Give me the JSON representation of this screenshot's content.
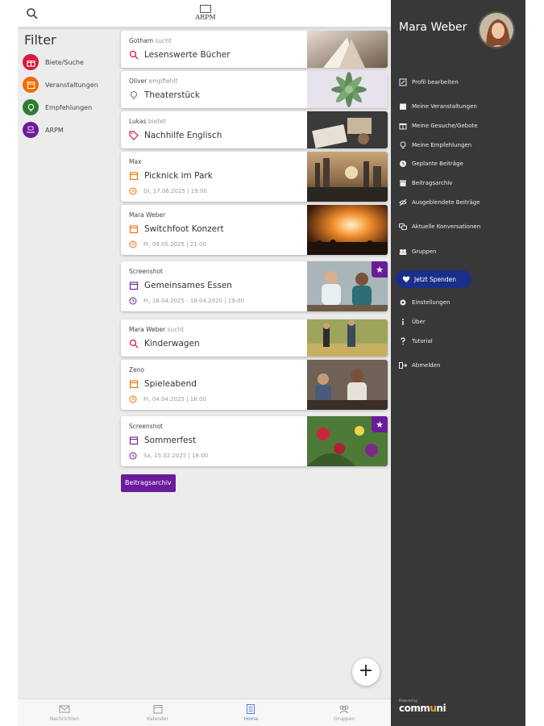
{
  "topbar": {
    "logo_text": "ARPM",
    "search_icon": "search-icon"
  },
  "filter": {
    "title": "Filter",
    "items": [
      {
        "label": "Biete/Suche",
        "color": "#d81b3c",
        "icon": "gift-icon"
      },
      {
        "label": "Veranstaltungen",
        "color": "#ef6c00",
        "icon": "calendar-icon"
      },
      {
        "label": "Empfehlungen",
        "color": "#2e7d32",
        "icon": "lightbulb-icon"
      },
      {
        "label": "ARPM",
        "color": "#6a1b9a",
        "icon": "arpm-logo-icon"
      }
    ]
  },
  "feed": {
    "cards": [
      {
        "author": "Gotham",
        "verb": "sucht",
        "title": "Lesenswerte Bücher",
        "icon": "search-icon",
        "icon_color": "#d81b3c",
        "date": "",
        "starred": false,
        "thumb": "book-photo"
      },
      {
        "author": "Oliver",
        "verb": "empfiehlt",
        "title": "Theaterstück",
        "icon": "lightbulb-icon",
        "icon_color": "#2e7d32",
        "date": "",
        "starred": false,
        "thumb": "succulent-photo"
      },
      {
        "author": "Lukas",
        "verb": "bietet",
        "title": "Nachhilfe Englisch",
        "icon": "tag-icon",
        "icon_color": "#d81b3c",
        "date": "",
        "starred": false,
        "thumb": "study-photo"
      },
      {
        "author": "Max",
        "verb": "",
        "title": "Picknick im Park",
        "icon": "calendar-icon",
        "icon_color": "#ef6c00",
        "date": "Di, 17.06.2025 | 19:00",
        "date_icon_color": "#ef6c00",
        "starred": false,
        "thumb": "city-sunset-photo"
      },
      {
        "author": "Mara Weber",
        "verb": "",
        "title": "Switchfoot Konzert",
        "icon": "calendar-icon",
        "icon_color": "#ef6c00",
        "date": "Fr, 09.05.2025 | 21:00",
        "date_icon_color": "#ef6c00",
        "starred": false,
        "thumb": "concert-photo"
      },
      {
        "author": "Screenshot",
        "verb": "",
        "title": "Gemeinsames Essen",
        "icon": "calendar-icon",
        "icon_color": "#6a1b9a",
        "date": "Fr, 18.04.2025 - 18.04.2020 | 19:00",
        "date_icon_color": "#6a1b9a",
        "starred": true,
        "thumb": "friends-photo"
      },
      {
        "author": "Mara Weber",
        "verb": "sucht",
        "title": "Kinderwagen",
        "icon": "search-icon",
        "icon_color": "#d81b3c",
        "date": "",
        "starred": false,
        "thumb": "park-family-photo"
      },
      {
        "author": "Zeno",
        "verb": "",
        "title": "Spieleabend",
        "icon": "calendar-icon",
        "icon_color": "#ef6c00",
        "date": "Fr, 04.04.2025 | 18:00",
        "date_icon_color": "#ef6c00",
        "starred": false,
        "thumb": "game-night-photo"
      },
      {
        "author": "Screenshot",
        "verb": "",
        "title": "Sommerfest",
        "icon": "calendar-icon",
        "icon_color": "#6a1b9a",
        "date": "Sa, 15.02.2025 | 18:00",
        "date_icon_color": "#6a1b9a",
        "starred": true,
        "thumb": "flowers-photo"
      }
    ],
    "archive_button": "Beitragsarchiv"
  },
  "fab": {
    "label": "+"
  },
  "bottomnav": {
    "items": [
      {
        "label": "Nachrichten",
        "icon": "mail-icon",
        "active": false
      },
      {
        "label": "Kalender",
        "icon": "calendar-icon",
        "active": false
      },
      {
        "label": "Home",
        "icon": "list-icon",
        "active": true
      },
      {
        "label": "Gruppen",
        "icon": "group-icon",
        "active": false
      }
    ]
  },
  "drawer": {
    "user_name": "Mara Weber",
    "menu": [
      {
        "label": "Profil bearbeiten",
        "icon": "edit-icon"
      },
      {
        "label": "Meine Veranstaltungen",
        "icon": "calendar-icon"
      },
      {
        "label": "Meine Gesuche/Gebote",
        "icon": "gift-icon"
      },
      {
        "label": "Meine Empfehlungen",
        "icon": "lightbulb-icon"
      },
      {
        "label": "Geplante Beiträge",
        "icon": "clock-icon"
      },
      {
        "label": "Beitragsarchiv",
        "icon": "archive-icon"
      },
      {
        "label": "Ausgeblendete Beiträge",
        "icon": "hidden-icon"
      },
      {
        "label": "Aktuelle Konversationen",
        "icon": "chat-icon"
      },
      {
        "label": "Gruppen",
        "icon": "group-icon"
      },
      {
        "label": "Jetzt Spenden",
        "icon": "heart-icon"
      },
      {
        "label": "Einstellungen",
        "icon": "gear-icon"
      },
      {
        "label": "Über",
        "icon": "info-icon"
      },
      {
        "label": "Tutorial",
        "icon": "question-icon"
      },
      {
        "label": "Abmelden",
        "icon": "logout-icon"
      }
    ],
    "brand_powered": "Powered by",
    "brand_name_a": "comm",
    "brand_name_b": "u",
    "brand_name_c": "ni"
  }
}
